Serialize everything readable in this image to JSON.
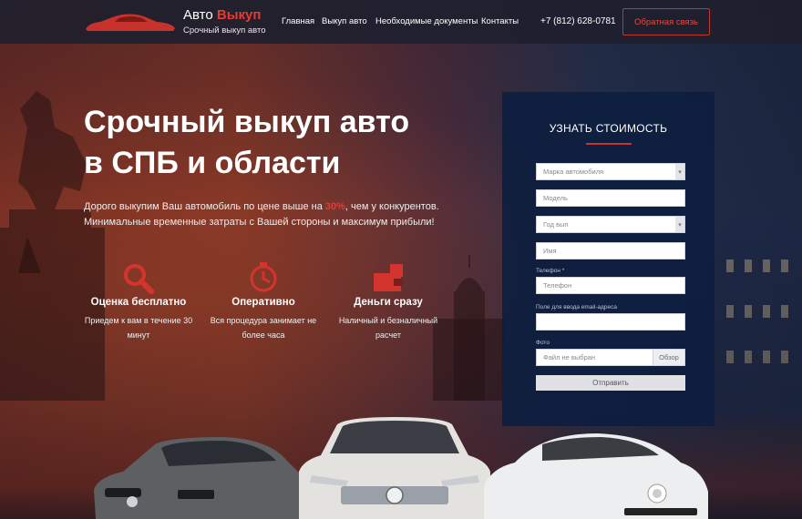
{
  "header": {
    "brand_main": "Авто",
    "brand_accent": "Выкуп",
    "brand_sub": "Срочный выкуп авто",
    "nav": [
      "Главная",
      "Выкуп авто",
      "Необходимые документы",
      "Контакты"
    ],
    "phone": "+7 (812) 628-0781",
    "cta": "Обратная связь"
  },
  "hero": {
    "title_line1": "Срочный выкуп авто",
    "title_line2": "в СПБ и области",
    "text_before": "Дорого выкупим Ваш автомобиль по цене выше на ",
    "text_highlight": "30%",
    "text_after": ", чем у конкурентов.",
    "text_line2": "Минимальные временные затраты с Вашей стороны и максимум прибыли!"
  },
  "features": [
    {
      "icon": "search-icon",
      "title": "Оценка бесплатно",
      "desc": "Приедем к вам в течение 30 минут"
    },
    {
      "icon": "clock-icon",
      "title": "Оперативно",
      "desc": "Вся процедура занимает не более часа"
    },
    {
      "icon": "wallet-icon",
      "title": "Деньги сразу",
      "desc": "Наличный и безналичный расчет"
    }
  ],
  "form": {
    "title": "УЗНАТЬ СТОИМОСТЬ",
    "brand_placeholder": "Марка автомобиля",
    "model_placeholder": "Модель",
    "year_placeholder": "Год вып",
    "name_placeholder": "Имя",
    "phone_label": "Телефон *",
    "phone_placeholder": "Телефон",
    "email_label": "Поле для ввода email-адреса",
    "photo_label": "Фото",
    "file_text": "Файл не выбран",
    "file_button": "Обзор",
    "submit": "Отправить"
  },
  "colors": {
    "accent": "#e63a32",
    "panel": "#0e1e40",
    "header": "#1e202e"
  }
}
